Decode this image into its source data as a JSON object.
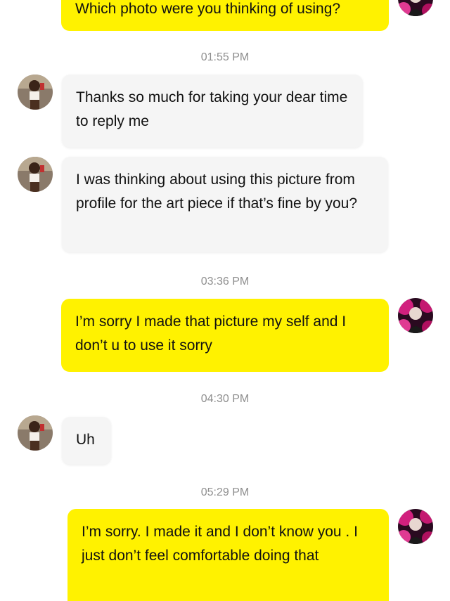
{
  "messages": [
    {
      "text": "Which photo were you thinking of using?"
    },
    {
      "text": "Thanks so much for taking your dear time to reply me"
    },
    {
      "text": "I was thinking about using this picture from profile for the art piece if that’s fine by you?"
    },
    {
      "text": "I’m sorry I made that picture my self and I don’t u to use it sorry"
    },
    {
      "text": "Uh"
    },
    {
      "text": "I’m sorry. I made it and I don’t know you . I just don’t feel comfortable doing that"
    }
  ],
  "timestamps": [
    "01:55 PM",
    "03:36 PM",
    "04:30 PM",
    "05:29 PM"
  ],
  "colors": {
    "outgoing_bubble": "#fff200",
    "incoming_bubble": "#f5f5f5",
    "timestamp_text": "#8e8e8e"
  },
  "icons": {
    "incoming_avatar": "user-photo-avatar",
    "outgoing_avatar": "user-photo-avatar-pink"
  }
}
